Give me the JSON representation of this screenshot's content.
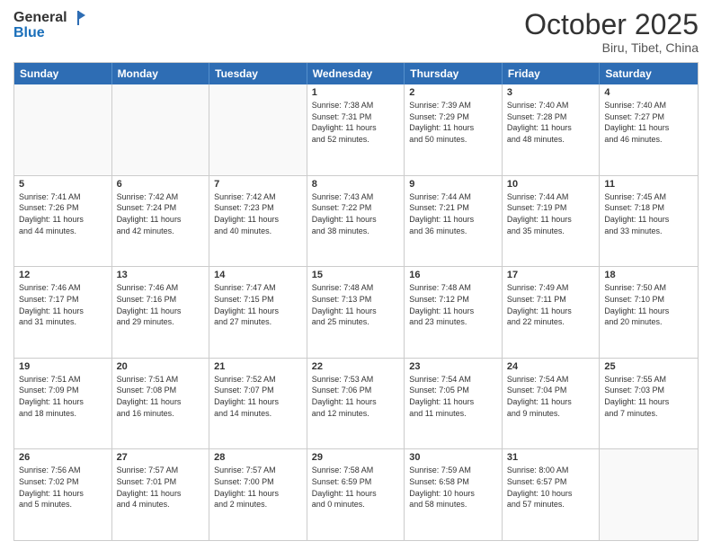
{
  "header": {
    "logo": {
      "line1": "General",
      "line2": "Blue"
    },
    "title": "October 2025",
    "location": "Biru, Tibet, China"
  },
  "dayHeaders": [
    "Sunday",
    "Monday",
    "Tuesday",
    "Wednesday",
    "Thursday",
    "Friday",
    "Saturday"
  ],
  "weeks": [
    [
      {
        "day": "",
        "info": ""
      },
      {
        "day": "",
        "info": ""
      },
      {
        "day": "",
        "info": ""
      },
      {
        "day": "1",
        "info": "Sunrise: 7:38 AM\nSunset: 7:31 PM\nDaylight: 11 hours\nand 52 minutes."
      },
      {
        "day": "2",
        "info": "Sunrise: 7:39 AM\nSunset: 7:29 PM\nDaylight: 11 hours\nand 50 minutes."
      },
      {
        "day": "3",
        "info": "Sunrise: 7:40 AM\nSunset: 7:28 PM\nDaylight: 11 hours\nand 48 minutes."
      },
      {
        "day": "4",
        "info": "Sunrise: 7:40 AM\nSunset: 7:27 PM\nDaylight: 11 hours\nand 46 minutes."
      }
    ],
    [
      {
        "day": "5",
        "info": "Sunrise: 7:41 AM\nSunset: 7:26 PM\nDaylight: 11 hours\nand 44 minutes."
      },
      {
        "day": "6",
        "info": "Sunrise: 7:42 AM\nSunset: 7:24 PM\nDaylight: 11 hours\nand 42 minutes."
      },
      {
        "day": "7",
        "info": "Sunrise: 7:42 AM\nSunset: 7:23 PM\nDaylight: 11 hours\nand 40 minutes."
      },
      {
        "day": "8",
        "info": "Sunrise: 7:43 AM\nSunset: 7:22 PM\nDaylight: 11 hours\nand 38 minutes."
      },
      {
        "day": "9",
        "info": "Sunrise: 7:44 AM\nSunset: 7:21 PM\nDaylight: 11 hours\nand 36 minutes."
      },
      {
        "day": "10",
        "info": "Sunrise: 7:44 AM\nSunset: 7:19 PM\nDaylight: 11 hours\nand 35 minutes."
      },
      {
        "day": "11",
        "info": "Sunrise: 7:45 AM\nSunset: 7:18 PM\nDaylight: 11 hours\nand 33 minutes."
      }
    ],
    [
      {
        "day": "12",
        "info": "Sunrise: 7:46 AM\nSunset: 7:17 PM\nDaylight: 11 hours\nand 31 minutes."
      },
      {
        "day": "13",
        "info": "Sunrise: 7:46 AM\nSunset: 7:16 PM\nDaylight: 11 hours\nand 29 minutes."
      },
      {
        "day": "14",
        "info": "Sunrise: 7:47 AM\nSunset: 7:15 PM\nDaylight: 11 hours\nand 27 minutes."
      },
      {
        "day": "15",
        "info": "Sunrise: 7:48 AM\nSunset: 7:13 PM\nDaylight: 11 hours\nand 25 minutes."
      },
      {
        "day": "16",
        "info": "Sunrise: 7:48 AM\nSunset: 7:12 PM\nDaylight: 11 hours\nand 23 minutes."
      },
      {
        "day": "17",
        "info": "Sunrise: 7:49 AM\nSunset: 7:11 PM\nDaylight: 11 hours\nand 22 minutes."
      },
      {
        "day": "18",
        "info": "Sunrise: 7:50 AM\nSunset: 7:10 PM\nDaylight: 11 hours\nand 20 minutes."
      }
    ],
    [
      {
        "day": "19",
        "info": "Sunrise: 7:51 AM\nSunset: 7:09 PM\nDaylight: 11 hours\nand 18 minutes."
      },
      {
        "day": "20",
        "info": "Sunrise: 7:51 AM\nSunset: 7:08 PM\nDaylight: 11 hours\nand 16 minutes."
      },
      {
        "day": "21",
        "info": "Sunrise: 7:52 AM\nSunset: 7:07 PM\nDaylight: 11 hours\nand 14 minutes."
      },
      {
        "day": "22",
        "info": "Sunrise: 7:53 AM\nSunset: 7:06 PM\nDaylight: 11 hours\nand 12 minutes."
      },
      {
        "day": "23",
        "info": "Sunrise: 7:54 AM\nSunset: 7:05 PM\nDaylight: 11 hours\nand 11 minutes."
      },
      {
        "day": "24",
        "info": "Sunrise: 7:54 AM\nSunset: 7:04 PM\nDaylight: 11 hours\nand 9 minutes."
      },
      {
        "day": "25",
        "info": "Sunrise: 7:55 AM\nSunset: 7:03 PM\nDaylight: 11 hours\nand 7 minutes."
      }
    ],
    [
      {
        "day": "26",
        "info": "Sunrise: 7:56 AM\nSunset: 7:02 PM\nDaylight: 11 hours\nand 5 minutes."
      },
      {
        "day": "27",
        "info": "Sunrise: 7:57 AM\nSunset: 7:01 PM\nDaylight: 11 hours\nand 4 minutes."
      },
      {
        "day": "28",
        "info": "Sunrise: 7:57 AM\nSunset: 7:00 PM\nDaylight: 11 hours\nand 2 minutes."
      },
      {
        "day": "29",
        "info": "Sunrise: 7:58 AM\nSunset: 6:59 PM\nDaylight: 11 hours\nand 0 minutes."
      },
      {
        "day": "30",
        "info": "Sunrise: 7:59 AM\nSunset: 6:58 PM\nDaylight: 10 hours\nand 58 minutes."
      },
      {
        "day": "31",
        "info": "Sunrise: 8:00 AM\nSunset: 6:57 PM\nDaylight: 10 hours\nand 57 minutes."
      },
      {
        "day": "",
        "info": ""
      }
    ]
  ]
}
